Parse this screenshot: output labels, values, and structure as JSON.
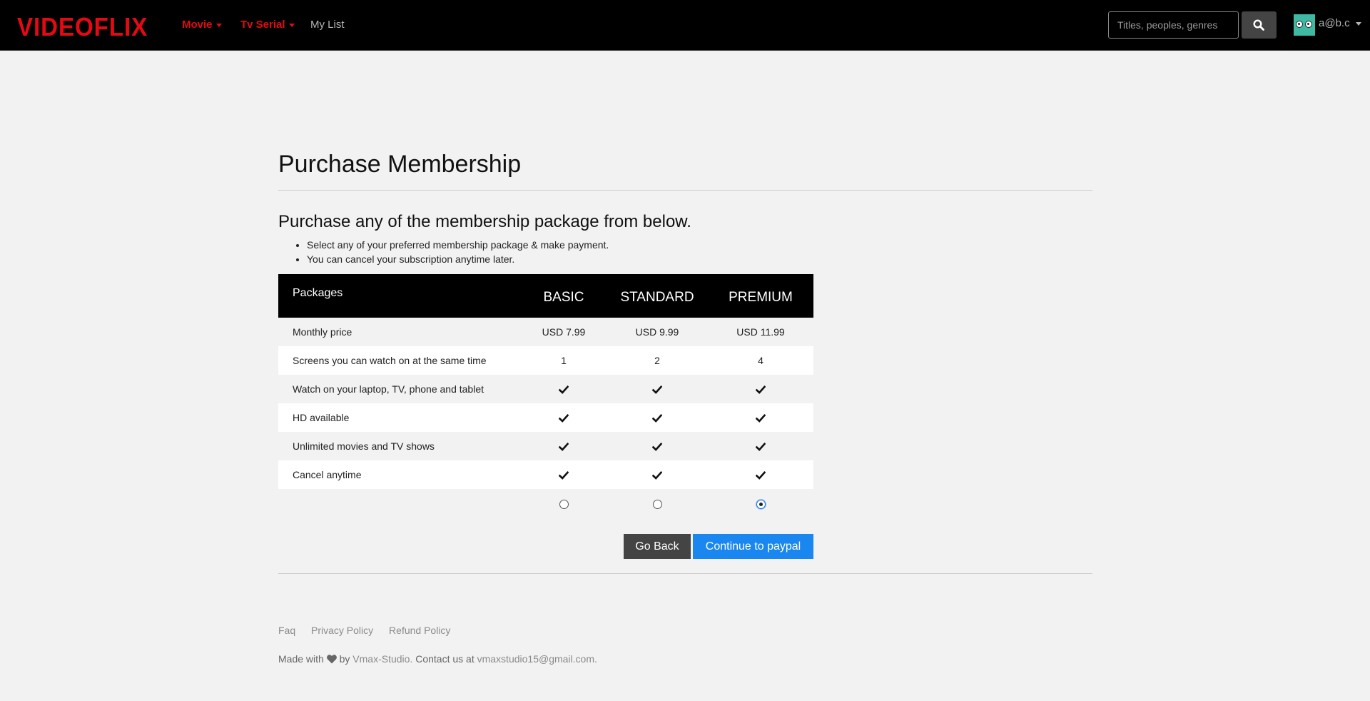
{
  "nav": {
    "logo": "VIDEOFLIX",
    "movie": "Movie",
    "tv_serial": "Tv Serial",
    "my_list": "My List",
    "search_placeholder": "Titles, peoples, genres",
    "user": "a@b.c"
  },
  "main": {
    "title": "Purchase Membership",
    "subtitle": "Purchase any of the membership package from below.",
    "bullets": [
      "Select any of your preferred membership package & make payment.",
      "You can cancel your subscription anytime later."
    ],
    "table": {
      "header_label": "Packages",
      "plans": [
        "BASIC",
        "STANDARD",
        "PREMIUM"
      ],
      "rows": [
        {
          "feature": "Monthly price",
          "values": [
            "USD 7.99",
            "USD 9.99",
            "USD 11.99"
          ]
        },
        {
          "feature": "Screens you can watch on at the same time",
          "values": [
            "1",
            "2",
            "4"
          ]
        },
        {
          "feature": "Watch on your laptop, TV, phone and tablet",
          "values": [
            "check",
            "check",
            "check"
          ]
        },
        {
          "feature": "HD available",
          "values": [
            "check",
            "check",
            "check"
          ]
        },
        {
          "feature": "Unlimited movies and TV shows",
          "values": [
            "check",
            "check",
            "check"
          ]
        },
        {
          "feature": "Cancel anytime",
          "values": [
            "check",
            "check",
            "check"
          ]
        }
      ],
      "selected_plan": "PREMIUM"
    },
    "buttons": {
      "back": "Go Back",
      "continue": "Continue to paypal"
    }
  },
  "footer": {
    "links": [
      "Faq",
      "Privacy Policy",
      "Refund Policy"
    ],
    "made_with": "Made with",
    "by": "by",
    "studio": "Vmax-Studio.",
    "contact": "Contact us at",
    "email": "vmaxstudio15@gmail.com."
  },
  "colors": {
    "brand": "#e50914",
    "primary_button": "#1a87f0",
    "navbar": "#000000",
    "background": "#f2f2f2"
  }
}
